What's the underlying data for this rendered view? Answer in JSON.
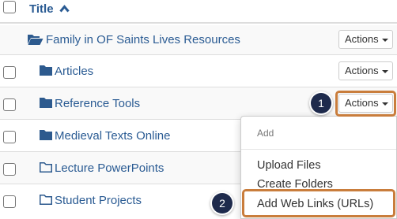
{
  "header": {
    "title": "Title",
    "sort_icon": "chevron-up-icon"
  },
  "rows": [
    {
      "label": "Family in OF Saints Lives Resources",
      "icon": "folder-open-icon",
      "actions": "Actions"
    },
    {
      "label": "Articles",
      "icon": "folder-icon",
      "actions": "Actions"
    },
    {
      "label": "Reference Tools",
      "icon": "folder-icon",
      "actions": "Actions"
    },
    {
      "label": "Medieval Texts Online",
      "icon": "folder-icon"
    },
    {
      "label": "Lecture PowerPoints",
      "icon": "folder-outline-icon"
    },
    {
      "label": "Student Projects",
      "icon": "folder-outline-icon"
    }
  ],
  "menu": {
    "header": "Add",
    "items": [
      "Upload Files",
      "Create Folders",
      "Add Web Links (URLs)"
    ]
  },
  "callouts": [
    "1",
    "2"
  ],
  "colors": {
    "link": "#2a5b93",
    "folder": "#2d5a8e",
    "callout_border": "#c97d3c",
    "badge": "#1e2a4c"
  }
}
